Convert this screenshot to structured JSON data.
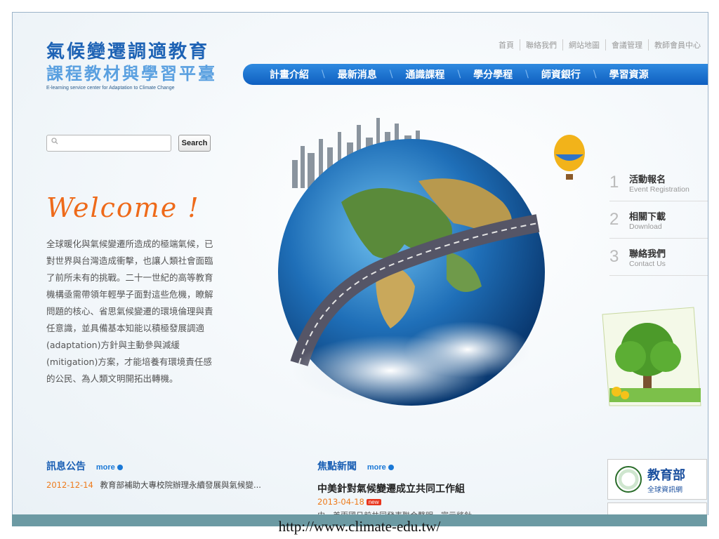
{
  "logo": {
    "line1": "氣候變遷調適教育",
    "line2": "課程教材與學習平臺",
    "line3": "E-learning service center for Adaptation to Climate Change"
  },
  "top_links": [
    "首頁",
    "聯絡我們",
    "網站地圖",
    "會議管理",
    "教師會員中心"
  ],
  "nav": [
    "計畫介紹",
    "最新消息",
    "通識課程",
    "學分學程",
    "師資銀行",
    "學習資源"
  ],
  "search": {
    "placeholder": "",
    "button": "Search"
  },
  "welcome": "Welcome !",
  "intro": "全球暖化與氣候變遷所造成的極端氣候，已對世界與台灣造成衝擊，也讓人類社會面臨了前所未有的挑戰。二十一世紀的高等教育機構亟需帶領年輕學子面對這些危機，瞭解問題的核心、省思氣候變遷的環境倫理與責任意識，並具備基本知能以積極發展調適(adaptation)方針與主動參與減緩(mitigation)方案，才能培養有環境責任感的公民、為人類文明開拓出轉機。",
  "right_menu": [
    {
      "num": "1",
      "title": "活動報名",
      "sub": "Event Registration"
    },
    {
      "num": "2",
      "title": "相關下載",
      "sub": "Download"
    },
    {
      "num": "3",
      "title": "聯絡我們",
      "sub": "Contact Us"
    }
  ],
  "announcements": {
    "heading": "訊息公告",
    "more": "more",
    "items": [
      {
        "date": "2012-12-14",
        "text": "教育部補助大專校院辦理永續發展與氣候變..."
      }
    ]
  },
  "focus_news": {
    "heading": "焦點新聞",
    "more": "more",
    "title": "中美針對氣候變遷成立共同工作組",
    "date": "2013-04-18",
    "badge": "new",
    "snippet": "中、美兩國日前共同發表聯合聲明，宣示將針..."
  },
  "partner": {
    "name": "教育部",
    "sub": "全球資訊網"
  },
  "footer_url": "http://www.climate-edu.tw/",
  "colors": {
    "nav_blue": "#1a6fd0",
    "welcome_orange": "#ee6a1a",
    "date_orange": "#ee7a1a",
    "footer_bar": "#6c9aa3"
  }
}
